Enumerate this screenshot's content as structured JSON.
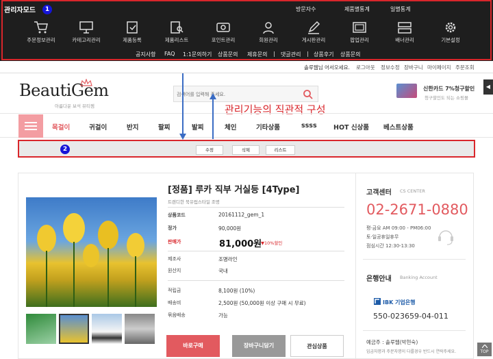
{
  "admin": {
    "title": "관리자모드",
    "badge": "1",
    "stats": [
      "방문자수",
      "제품별통계",
      "일별통계"
    ],
    "icons": [
      {
        "label": "주문정보관리",
        "icon": "cart-icon"
      },
      {
        "label": "카테고리관리",
        "icon": "category-icon"
      },
      {
        "label": "제품등록",
        "icon": "product-register-icon"
      },
      {
        "label": "제품리스트",
        "icon": "product-list-icon"
      },
      {
        "label": "포인트관리",
        "icon": "point-icon"
      },
      {
        "label": "회원관리",
        "icon": "member-icon"
      },
      {
        "label": "게시판관리",
        "icon": "board-icon"
      },
      {
        "label": "팝업관리",
        "icon": "popup-icon"
      },
      {
        "label": "배너관리",
        "icon": "banner-icon"
      },
      {
        "label": "기본설정",
        "icon": "settings-icon"
      }
    ],
    "submenu": [
      "공지사항",
      "FAQ",
      "1:1문의하기",
      "상품문의",
      "제휴문의",
      "|",
      "댓글관리",
      "|",
      "상품후기",
      "상품문의"
    ]
  },
  "userbar": [
    "솔루웹님 어서오세요.",
    "로그아웃",
    "정보수정",
    "장바구니",
    "마이페이지",
    "주문조회"
  ],
  "logo": {
    "name": "BeautiGem",
    "tagline": "아름다운 보석 뷰티젬"
  },
  "search": {
    "placeholder": "검색어를 입력해 주세요."
  },
  "annotation": "관리기능의 직관적 구성",
  "promo": {
    "title": "신한카드 7%청구할인",
    "sub": "청구할인도 되는 쇼핑몰"
  },
  "sidetab": "◀",
  "nav": [
    "목걸이",
    "귀걸이",
    "반지",
    "팔찌",
    "발찌",
    "체인",
    "기타상품",
    "ssss",
    "HOT 신상품",
    "베스트상품"
  ],
  "actionbar": {
    "badge": "2",
    "buttons": [
      "수정",
      "삭제",
      "리스트"
    ]
  },
  "product": {
    "title": "[정품] 루카 직부 거실등 [4Type]",
    "subtitle": "트렌디한 북유럽스타일 조명",
    "rows1": [
      {
        "label": "상품코드",
        "value": "20161112_gem_1"
      },
      {
        "label": "정가",
        "value": "90,000원"
      },
      {
        "label": "판매가",
        "value": ""
      }
    ],
    "price": "81,000원",
    "discount": "▼10%할인",
    "rows2": [
      {
        "label": "제조사",
        "value": "조명라인"
      },
      {
        "label": "원산지",
        "value": "국내"
      }
    ],
    "rows3": [
      {
        "label": "적립금",
        "value": "8,100원 (10%)"
      },
      {
        "label": "배송비",
        "value": "2,500원 (50,000원 이상 구매 시 무료)"
      },
      {
        "label": "묶음배송",
        "value": "가능"
      }
    ],
    "buttons": [
      "바로구매",
      "장바구니담기",
      "관심상품"
    ]
  },
  "cs": {
    "title": "고객센터",
    "title_en": "CS CENTER",
    "phone": "02-2671-0880",
    "hours": [
      "평·금요 AM 09:00 - PM06:00",
      "토·일공휴일휴무",
      "점심시간 12:30-13:30"
    ]
  },
  "bank": {
    "title": "은행안내",
    "title_en": "Banking Account",
    "bank_name": "IBK 기업은행",
    "account": "550-023659-04-011",
    "holder": "예금주 : 솔루웹(박현숙)",
    "note": "입금자명과 주문자명이 다를경우 반드시 연락주세요."
  },
  "top_button": "TOP",
  "colors": {
    "accent": "#e25a5f",
    "admin_bg": "#1e1e1e",
    "highlight": "#d9262b",
    "badge": "#1515d8"
  }
}
